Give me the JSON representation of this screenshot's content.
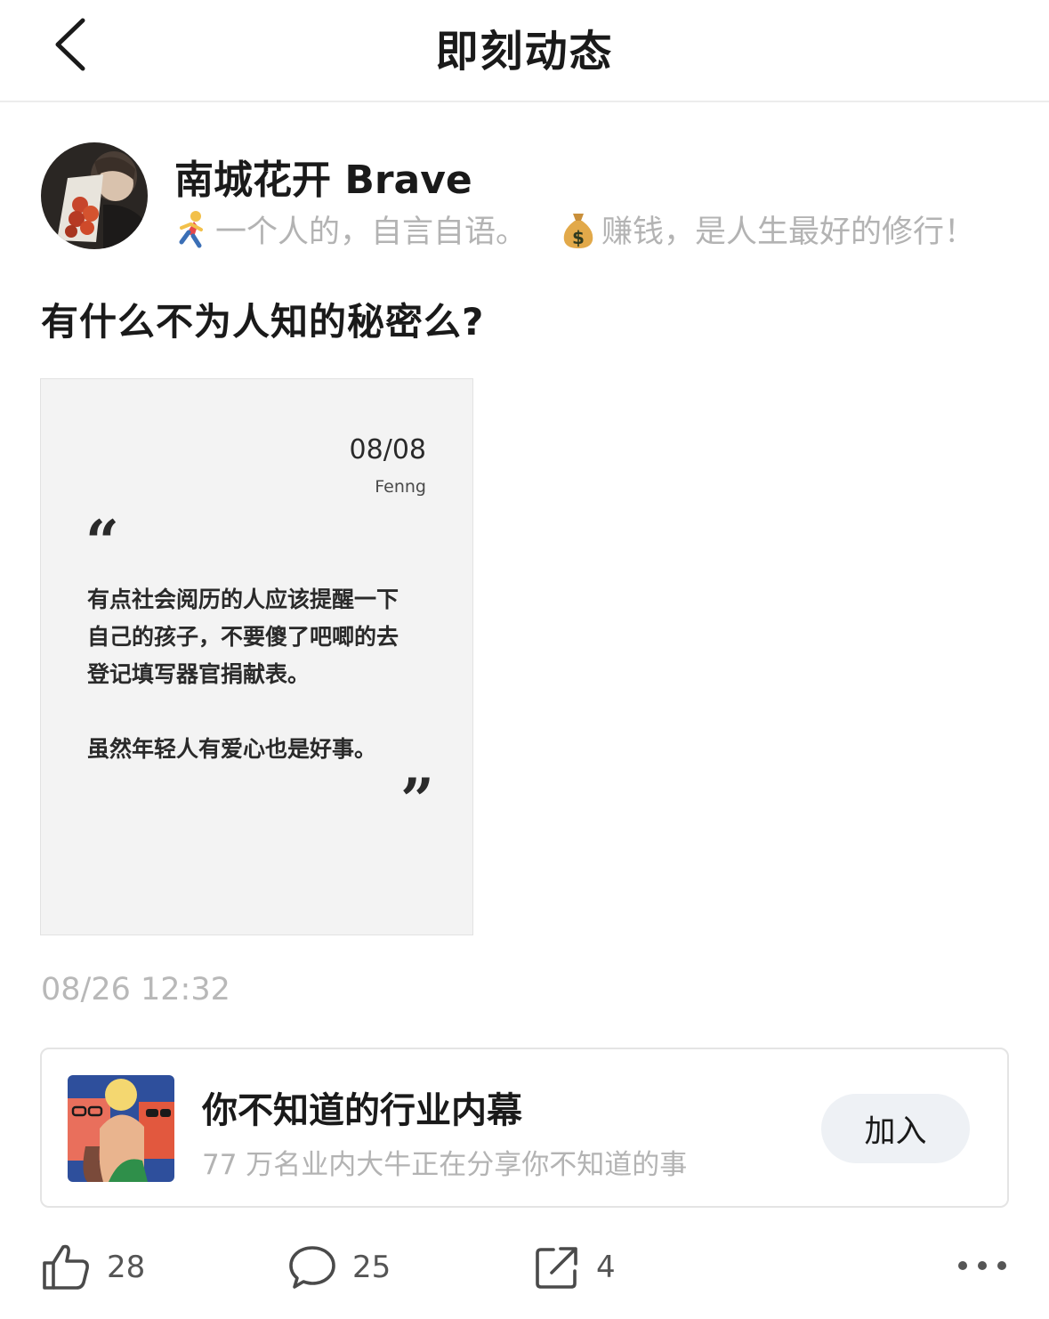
{
  "header": {
    "title": "即刻动态",
    "back_icon": "chevron-left-icon"
  },
  "author": {
    "name": "南城花开 Brave",
    "bio_part1": "一个人的，自言自语。",
    "bio_part2": "赚钱，是人生最好的修行！",
    "bio_icon1": "runner-emoji",
    "bio_icon2": "money-bag-emoji"
  },
  "post": {
    "text": "有什么不为人知的秘密么?",
    "image": {
      "date": "08/08",
      "author": "Fenng",
      "lines": [
        "有点社会阅历的人应该提醒一下",
        "自己的孩子，不要傻了吧唧的去",
        "登记填写器官捐献表。",
        "虽然年轻人有爱心也是好事。"
      ]
    },
    "timestamp": "08/26 12:32"
  },
  "group": {
    "name": "你不知道的行业内幕",
    "desc": "77 万名业内大牛正在分享你不知道的事",
    "join_label": "加入"
  },
  "actions": {
    "like_count": "28",
    "comment_count": "25",
    "share_count": "4"
  }
}
